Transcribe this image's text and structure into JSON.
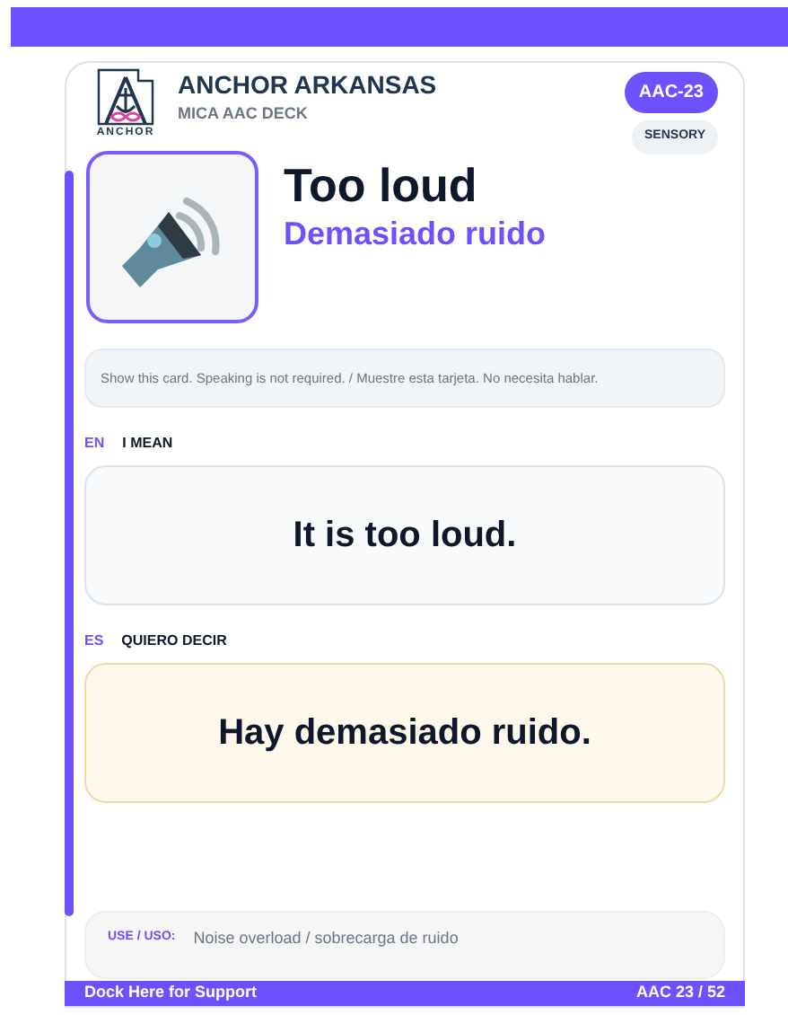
{
  "brand": {
    "logo_text": "ANCHOR",
    "name": "ANCHOR ARKANSAS",
    "subtitle": "MICA AAC DECK"
  },
  "badges": {
    "code": "AAC-23",
    "category": "SENSORY"
  },
  "card": {
    "title": "Too loud",
    "title_es": "Demasiado ruido",
    "instruction": "Show this card. Speaking is not required. / Muestre esta tarjeta. No necesita hablar."
  },
  "phrases": [
    {
      "lang": "EN",
      "label": "I MEAN",
      "text": "It is too loud.",
      "kind": "en"
    },
    {
      "lang": "ES",
      "label": "QUIERO DECIR",
      "text": "Hay demasiado ruido.",
      "kind": "es"
    }
  ],
  "use": {
    "label": "USE / USO:",
    "text": "Noise overload / sobrecarga de ruido"
  },
  "footer": {
    "left": "Dock Here for Support",
    "right": "AAC 23 / 52"
  }
}
